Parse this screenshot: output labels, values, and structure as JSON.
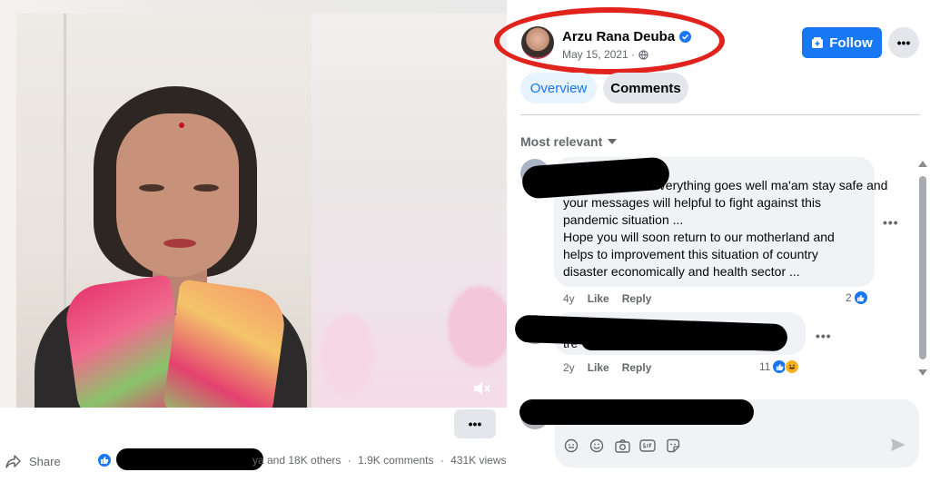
{
  "video": {
    "more_label": "•••"
  },
  "footer": {
    "share_label": "Share",
    "reactions_text": "ya and 18K others",
    "comments_count": "1.9K comments",
    "views_count": "431K views",
    "separator": "·"
  },
  "post": {
    "author": "Arzu Rana Deuba",
    "date": "May 15, 2021 ·",
    "follow_label": "Follow",
    "more_label": "•••"
  },
  "tabs": [
    {
      "label": "Overview"
    },
    {
      "label": "Comments"
    }
  ],
  "sort_label": "Most relevant",
  "comments": [
    {
      "lines": [
        "everything goes well ma'am stay safe and",
        "your messages will helpful to fight against this",
        "pandemic situation ...",
        "Hope you will soon return to our motherland and",
        "helps to improvement this situation of country",
        "disaster economically and health sector ..."
      ],
      "age": "4y",
      "like_label": "Like",
      "reply_label": "Reply",
      "reaction_count": "2",
      "more_label": "•••"
    },
    {
      "lines": [
        "tre",
        "\""
      ],
      "age": "2y",
      "like_label": "Like",
      "reply_label": "Reply",
      "reaction_count": "11",
      "more_label": "•••"
    }
  ],
  "composer": {
    "placeholder": ""
  },
  "colors": {
    "accent": "#1877f2",
    "annotation_red": "#e0231d",
    "redaction": "#000000"
  },
  "icons": [
    "share-icon",
    "like-reaction-icon",
    "verified-icon",
    "globe-icon",
    "follow-icon",
    "caret-down-icon",
    "mute-icon",
    "haha-reaction-icon",
    "avatar-sticker-icon",
    "emoji-icon",
    "camera-icon",
    "gif-icon",
    "sticker-icon",
    "send-icon",
    "scroll-up-icon",
    "scroll-down-icon"
  ]
}
